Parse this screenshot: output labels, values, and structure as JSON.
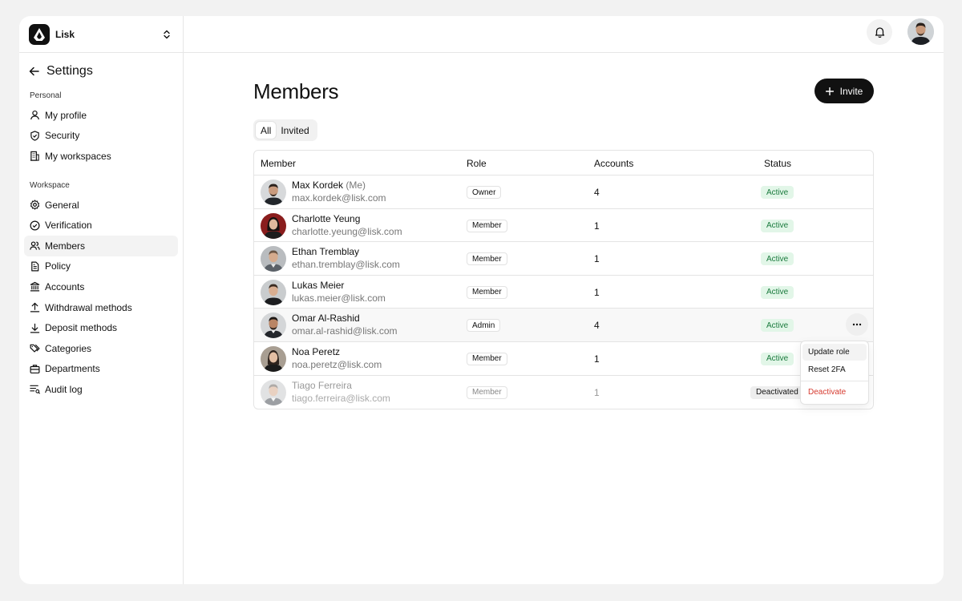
{
  "workspace": {
    "name": "Lisk"
  },
  "sidebar": {
    "title": "Settings",
    "personal_label": "Personal",
    "personal_items": [
      {
        "label": "My profile",
        "icon": "user-icon"
      },
      {
        "label": "Security",
        "icon": "shield-icon"
      },
      {
        "label": "My workspaces",
        "icon": "building-icon"
      }
    ],
    "workspace_label": "Workspace",
    "workspace_items": [
      {
        "label": "General",
        "icon": "gear-icon"
      },
      {
        "label": "Verification",
        "icon": "check-circle-icon"
      },
      {
        "label": "Members",
        "icon": "users-icon",
        "active": true
      },
      {
        "label": "Policy",
        "icon": "document-icon"
      },
      {
        "label": "Accounts",
        "icon": "bank-icon"
      },
      {
        "label": "Withdrawal methods",
        "icon": "upload-icon"
      },
      {
        "label": "Deposit methods",
        "icon": "download-icon"
      },
      {
        "label": "Categories",
        "icon": "tags-icon"
      },
      {
        "label": "Departments",
        "icon": "briefcase-icon"
      },
      {
        "label": "Audit log",
        "icon": "list-filter-icon"
      }
    ]
  },
  "main": {
    "title": "Members",
    "invite_label": "Invite",
    "tabs": [
      {
        "label": "All",
        "active": true
      },
      {
        "label": "Invited"
      }
    ],
    "table": {
      "headers": {
        "member": "Member",
        "role": "Role",
        "accounts": "Accounts",
        "status": "Status"
      },
      "rows": [
        {
          "name": "Max Kordek",
          "me": "(Me)",
          "email": "max.kordek@lisk.com",
          "role": "Owner",
          "accounts": "4",
          "status": "Active"
        },
        {
          "name": "Charlotte Yeung",
          "me": "",
          "email": "charlotte.yeung@lisk.com",
          "role": "Member",
          "accounts": "1",
          "status": "Active"
        },
        {
          "name": "Ethan Tremblay",
          "me": "",
          "email": "ethan.tremblay@lisk.com",
          "role": "Member",
          "accounts": "1",
          "status": "Active"
        },
        {
          "name": "Lukas Meier",
          "me": "",
          "email": "lukas.meier@lisk.com",
          "role": "Member",
          "accounts": "1",
          "status": "Active"
        },
        {
          "name": "Omar Al-Rashid",
          "me": "",
          "email": "omar.al-rashid@lisk.com",
          "role": "Admin",
          "accounts": "4",
          "status": "Active"
        },
        {
          "name": "Noa Peretz",
          "me": "",
          "email": "noa.peretz@lisk.com",
          "role": "Member",
          "accounts": "1",
          "status": "Active"
        },
        {
          "name": "Tiago Ferreira",
          "me": "",
          "email": "tiago.ferreira@lisk.com",
          "role": "Member",
          "accounts": "1",
          "status": "Deactivated"
        }
      ]
    },
    "row_menu": {
      "update_role": "Update role",
      "reset_2fa": "Reset 2FA",
      "deactivate": "Deactivate"
    }
  },
  "colors": {
    "accent": "#111111",
    "active_bg": "#e2f6e8",
    "active_text": "#1a7a3d",
    "danger": "#d63a2f"
  }
}
